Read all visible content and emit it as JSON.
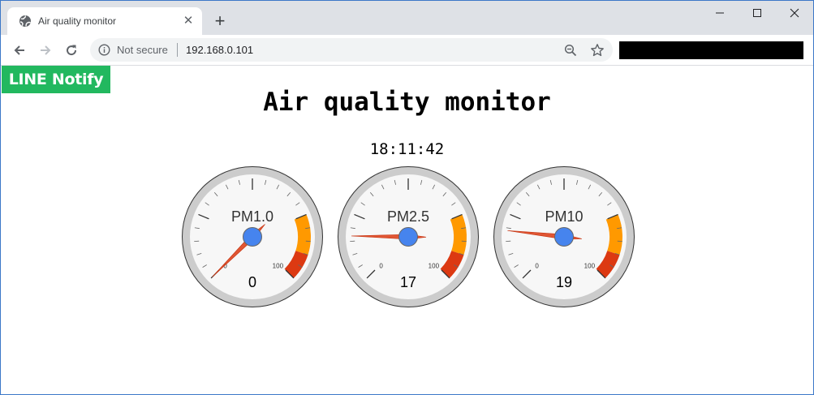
{
  "browser": {
    "tab": {
      "title": "Air quality monitor",
      "icon": "globe-icon",
      "close_icon": "close-icon"
    },
    "new_tab_icon": "plus-icon",
    "window_controls": [
      "minimize-icon",
      "maximize-icon",
      "close-icon"
    ],
    "omnibox": {
      "security_icon": "info-icon",
      "security_label": "Not secure",
      "url": "192.168.0.101",
      "zoom_icon": "zoom-icon",
      "bookmark_icon": "star-icon"
    }
  },
  "page": {
    "badge": "LINE Notify",
    "title": "Air quality monitor",
    "time": "18:11:42"
  },
  "gauges": [
    {
      "label": "PM1.0",
      "value": 0,
      "value_text": "0",
      "min": 0,
      "max": 100,
      "min_label": "0",
      "max_label": "100"
    },
    {
      "label": "PM2.5",
      "value": 17,
      "value_text": "17",
      "min": 0,
      "max": 100,
      "min_label": "0",
      "max_label": "100"
    },
    {
      "label": "PM10",
      "value": 19,
      "value_text": "19",
      "min": 0,
      "max": 100,
      "min_label": "0",
      "max_label": "100"
    }
  ],
  "colors": {
    "yellow_zone": "#ff9900",
    "red_zone": "#dc3912",
    "needle": "#dc3912",
    "hub": "#4684ee",
    "badge": "#22b85f"
  }
}
